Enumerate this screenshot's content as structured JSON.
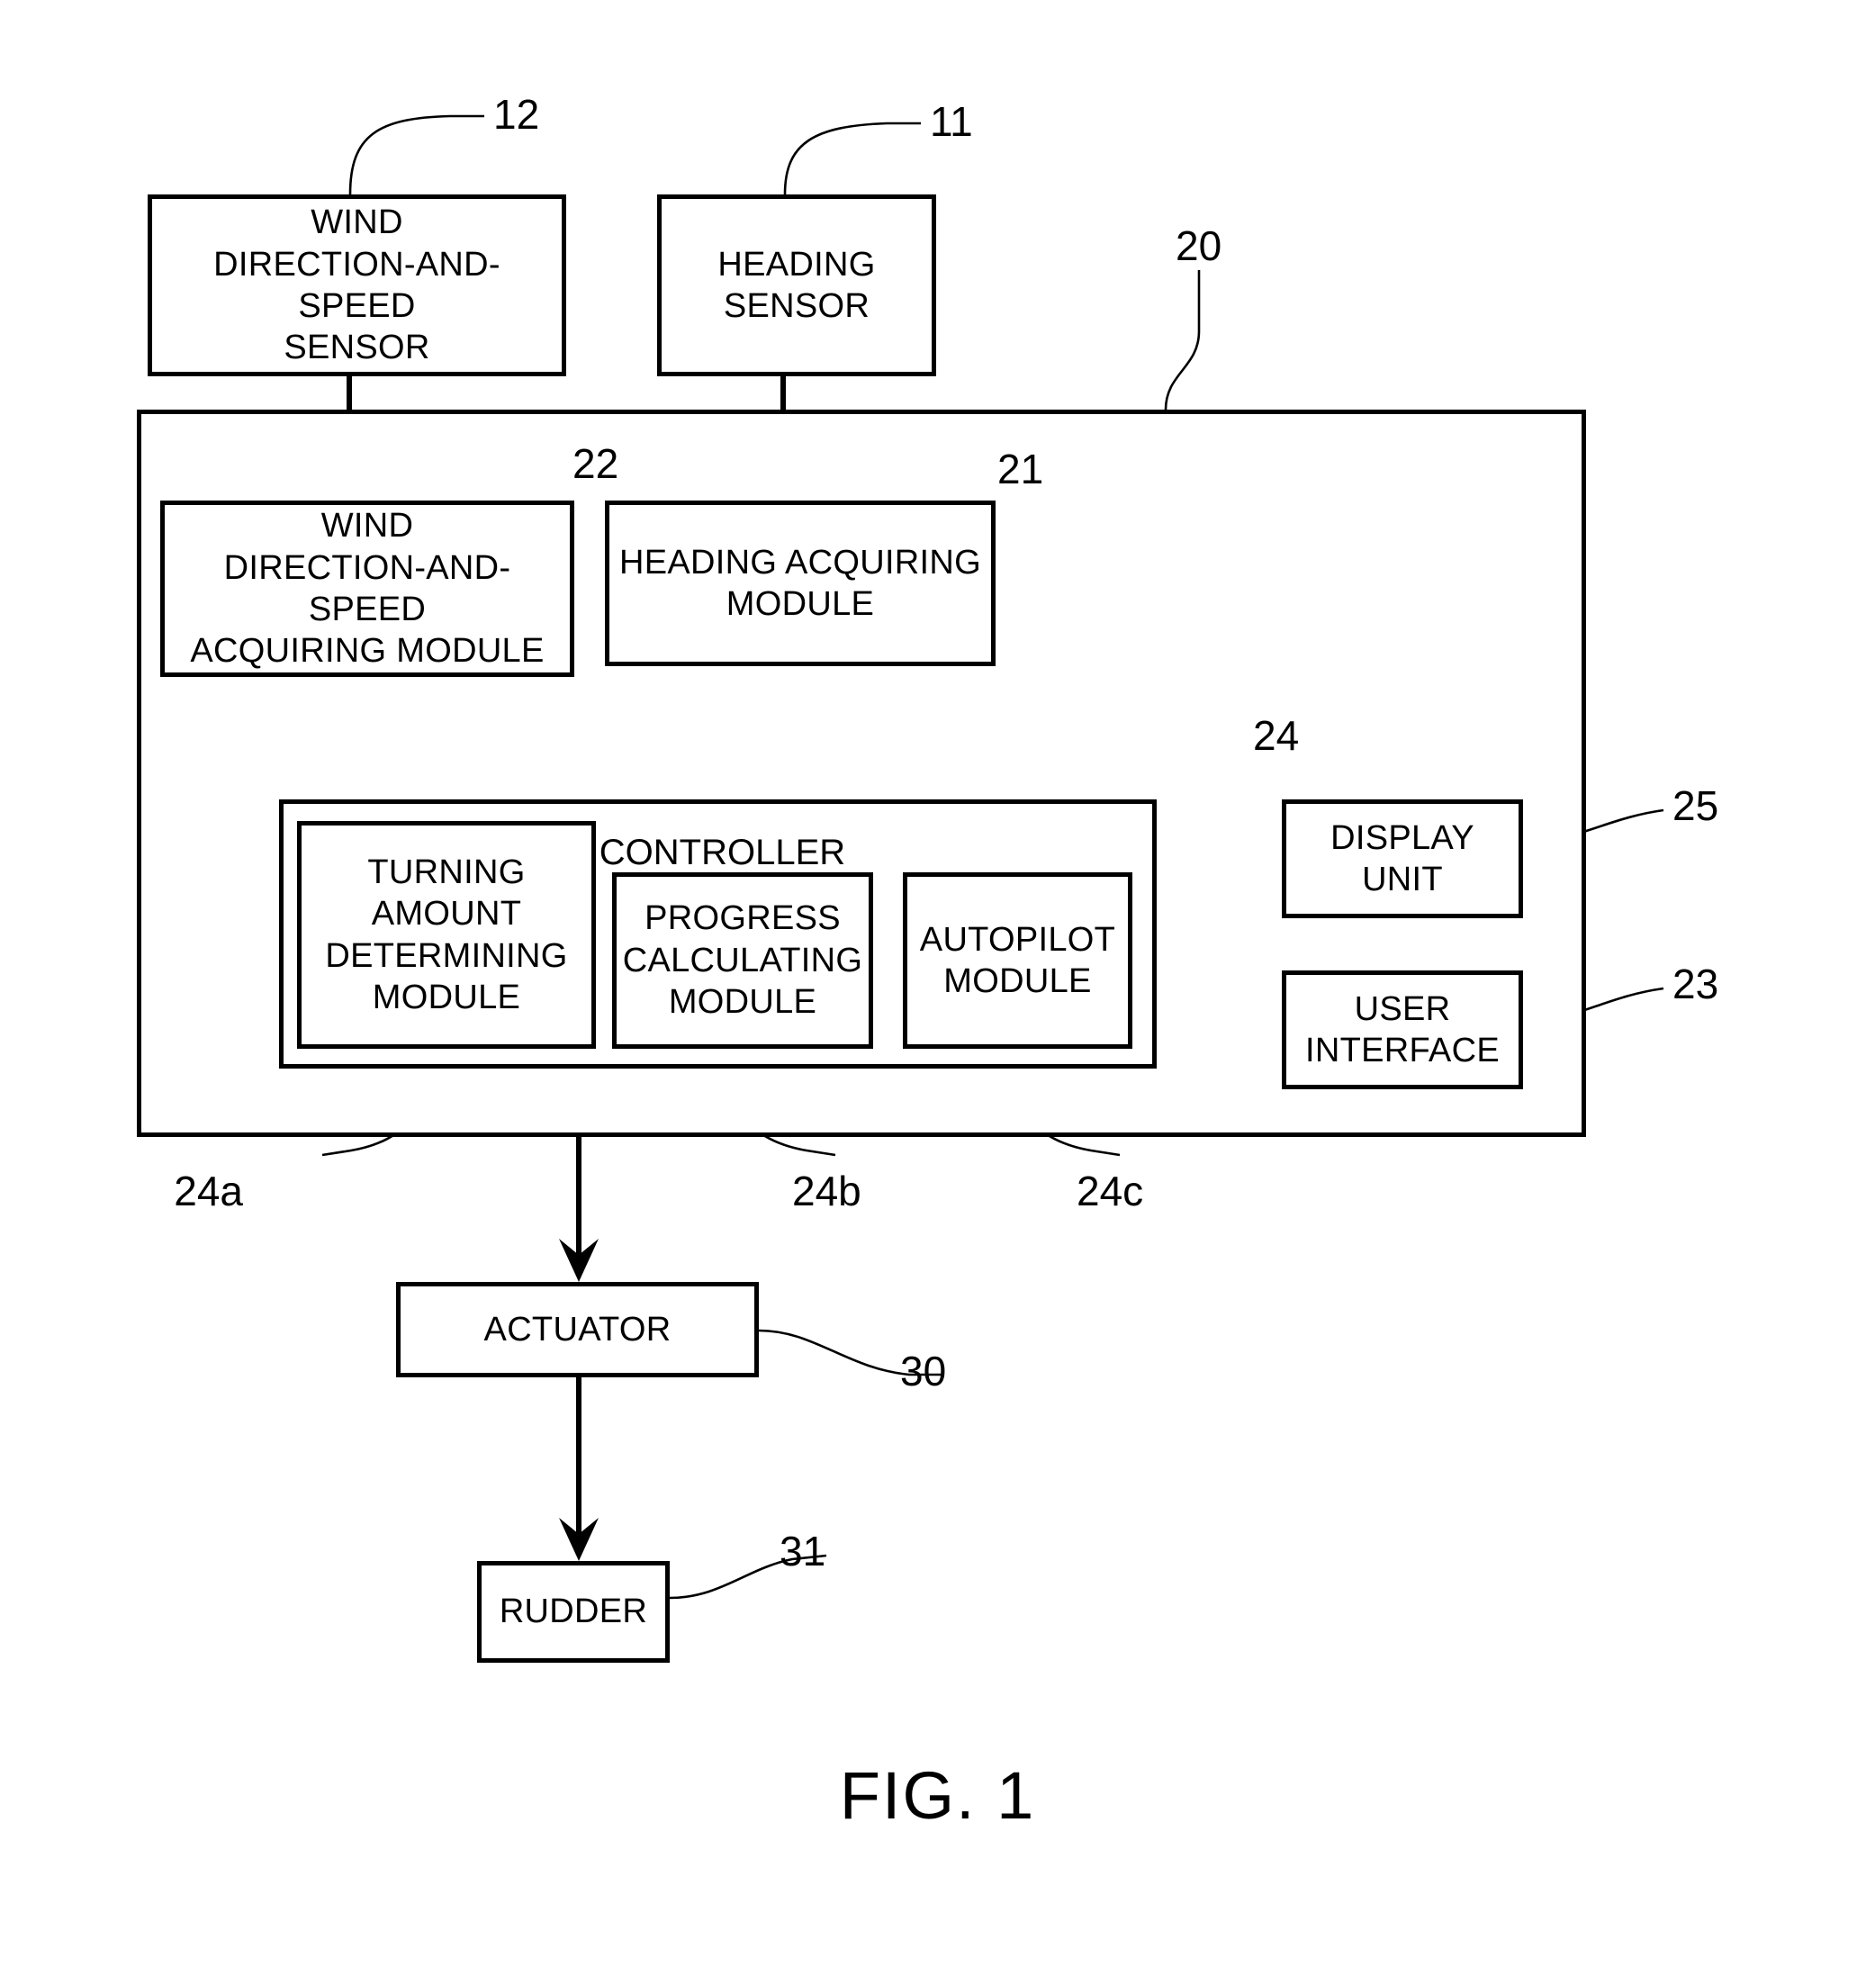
{
  "figure": {
    "caption": "FIG. 1"
  },
  "blocks": {
    "wind_sensor": {
      "label": "WIND\nDIRECTION-AND-SPEED\nSENSOR",
      "ref": "12"
    },
    "heading_sensor": {
      "label": "HEADING\nSENSOR",
      "ref": "11"
    },
    "control_device": {
      "label": "",
      "ref": "20"
    },
    "wind_acquiring": {
      "label": "WIND\nDIRECTION-AND-SPEED\nACQUIRING MODULE",
      "ref": "22"
    },
    "heading_acquiring": {
      "label": "HEADING ACQUIRING\nMODULE",
      "ref": "21"
    },
    "controller": {
      "label": "CONTROLLER",
      "ref": "24"
    },
    "turning_amount": {
      "label": "TURNING\nAMOUNT\nDETERMINING\nMODULE",
      "ref": "24a"
    },
    "progress_calc": {
      "label": "PROGRESS\nCALCULATING\nMODULE",
      "ref": "24b"
    },
    "autopilot": {
      "label": "AUTOPILOT\nMODULE",
      "ref": "24c"
    },
    "display_unit": {
      "label": "DISPLAY\nUNIT",
      "ref": "25"
    },
    "user_interface": {
      "label": "USER\nINTERFACE",
      "ref": "23"
    },
    "actuator": {
      "label": "ACTUATOR",
      "ref": "30"
    },
    "rudder": {
      "label": "RUDDER",
      "ref": "31"
    }
  },
  "colors": {
    "ink": "#000000",
    "paper": "#ffffff"
  }
}
